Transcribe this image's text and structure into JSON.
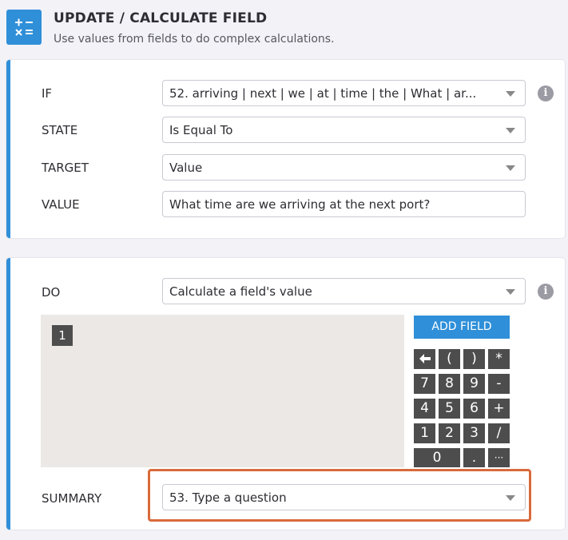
{
  "header": {
    "title": "UPDATE / CALCULATE FIELD",
    "subtitle": "Use values from fields to do complex calculations.",
    "icon": "calculator-icon"
  },
  "condition": {
    "if_label": "IF",
    "if_value": "52. arriving | next | we | at | time | the | What | ar...",
    "state_label": "STATE",
    "state_value": "Is Equal To",
    "target_label": "TARGET",
    "target_value": "Value",
    "value_label": "VALUE",
    "value_value": "What time are we arriving at the next port?"
  },
  "action": {
    "do_label": "DO",
    "do_value": "Calculate a field's value",
    "formula_token": "1",
    "add_field_label": "ADD FIELD",
    "keypad": {
      "row1": [
        "(",
        ")",
        "*"
      ],
      "row2": [
        "7",
        "8",
        "9",
        "-"
      ],
      "row3": [
        "4",
        "5",
        "6",
        "+"
      ],
      "row4": [
        "1",
        "2",
        "3",
        "/"
      ],
      "row5": [
        "0",
        ".",
        "···"
      ]
    },
    "summary_label": "SUMMARY",
    "summary_value": "53. Type a question"
  },
  "colors": {
    "accent": "#2f8fd9",
    "highlight": "#d96a3b",
    "key_bg": "#4d4d4d",
    "calc_bg": "#ebe8e5"
  }
}
